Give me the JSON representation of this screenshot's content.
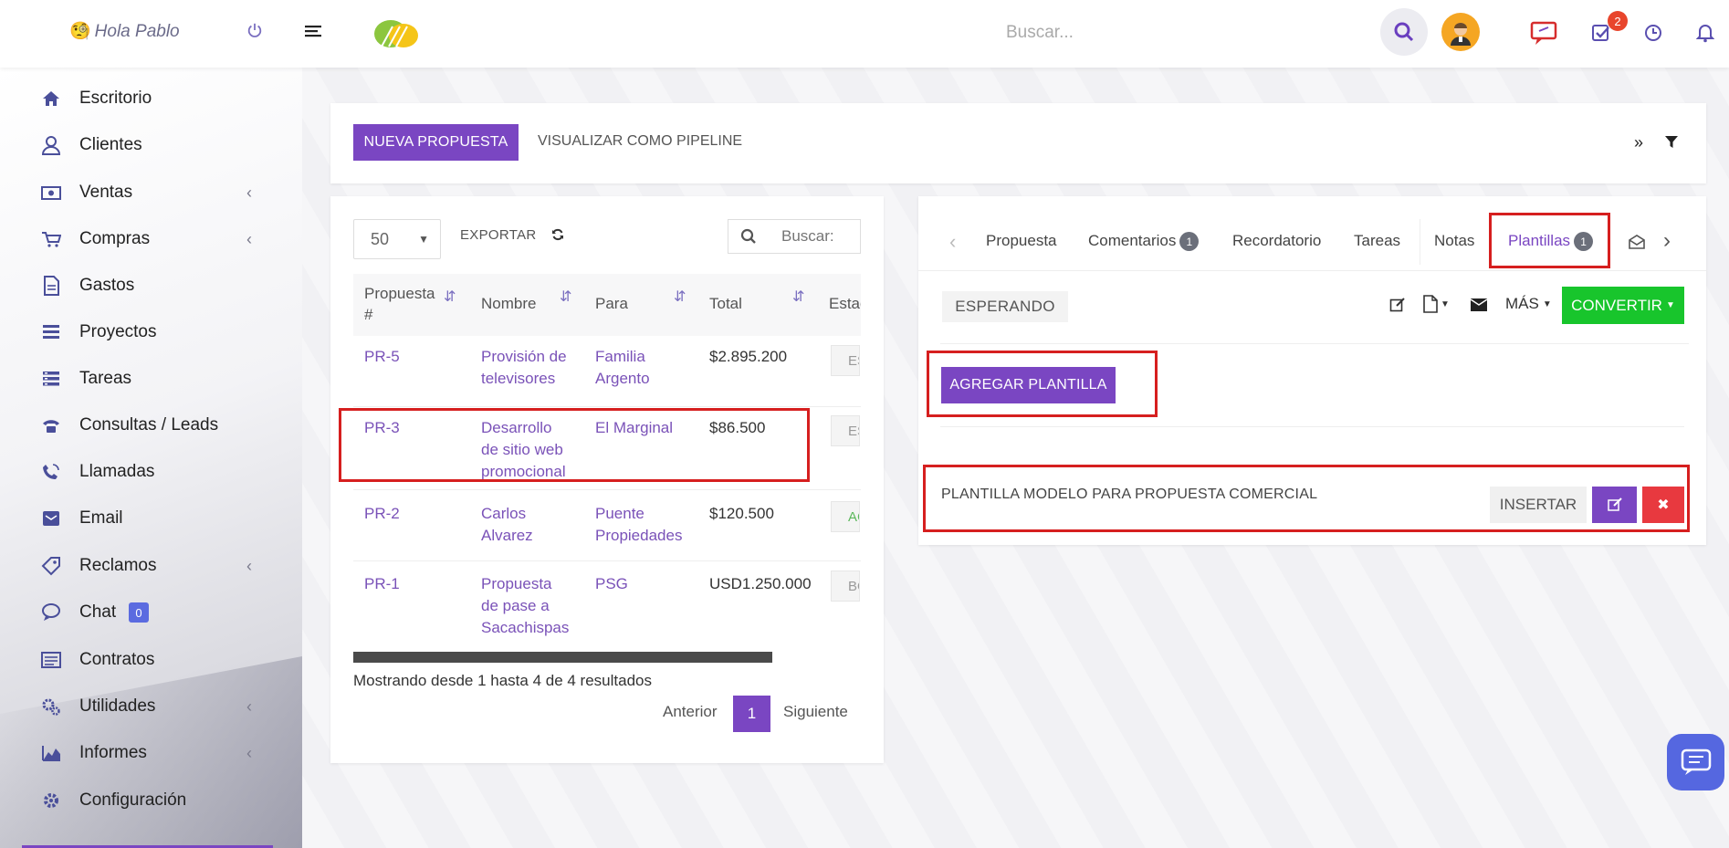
{
  "topbar": {
    "greeting": "Hola Pablo",
    "search_placeholder": "Buscar...",
    "notifications_badge": "2",
    "colors": {
      "accent": "#7a46c2",
      "badge": "#e8452c"
    }
  },
  "sidebar": {
    "items": [
      {
        "label": "Escritorio",
        "icon": "home-icon"
      },
      {
        "label": "Clientes",
        "icon": "user-icon"
      },
      {
        "label": "Ventas",
        "icon": "money-icon",
        "chevron": true
      },
      {
        "label": "Compras",
        "icon": "cart-icon",
        "chevron": true
      },
      {
        "label": "Gastos",
        "icon": "document-icon"
      },
      {
        "label": "Proyectos",
        "icon": "list-icon"
      },
      {
        "label": "Tareas",
        "icon": "tasks-icon"
      },
      {
        "label": "Consultas / Leads",
        "icon": "phone-icon"
      },
      {
        "label": "Llamadas",
        "icon": "call-icon"
      },
      {
        "label": "Email",
        "icon": "email-icon"
      },
      {
        "label": "Reclamos",
        "icon": "tag-icon",
        "chevron": true
      },
      {
        "label": "Chat",
        "icon": "chat-icon",
        "badge": "0"
      },
      {
        "label": "Contratos",
        "icon": "contract-icon"
      },
      {
        "label": "Utilidades",
        "icon": "cogs-icon",
        "chevron": true
      },
      {
        "label": "Informes",
        "icon": "area-chart-icon",
        "chevron": true
      },
      {
        "label": "Configuración",
        "icon": "gear-icon"
      }
    ]
  },
  "toolbar": {
    "new_label": "NUEVA PROPUESTA",
    "pipeline_label": "VISUALIZAR COMO PIPELINE"
  },
  "table": {
    "page_size": "50",
    "export_label": "EXPORTAR",
    "search_placeholder": "Buscar:",
    "headers": [
      "Propuesta #",
      "Nombre",
      "Para",
      "Total",
      "Estado"
    ],
    "rows": [
      {
        "id": "PR-5",
        "nombre": [
          "Provisión de",
          "televisores"
        ],
        "para": [
          "Familia",
          "Argento"
        ],
        "total": "$2.895.200",
        "estado": "ESPERANDO"
      },
      {
        "id": "PR-3",
        "nombre": [
          "Desarrollo",
          "de sitio web",
          "promocional"
        ],
        "para": [
          "El Marginal"
        ],
        "total": "$86.500",
        "estado": "ESPERANDO"
      },
      {
        "id": "PR-2",
        "nombre": [
          "Carlos",
          "Alvarez"
        ],
        "para": [
          "Puente",
          "Propiedades"
        ],
        "total": "$120.500",
        "estado": "ACEPTADO"
      },
      {
        "id": "PR-1",
        "nombre": [
          "Propuesta",
          "de pase a",
          "Sacachispas"
        ],
        "para": [
          "PSG"
        ],
        "total": "USD1.250.000",
        "estado": "BORRADOR"
      }
    ],
    "info": "Mostrando desde 1 hasta 4 de 4 resultados",
    "pagination": {
      "prev": "Anterior",
      "current": "1",
      "next": "Siguiente"
    }
  },
  "detail": {
    "tabs": [
      {
        "label": "Propuesta"
      },
      {
        "label": "Comentarios",
        "badge": "1"
      },
      {
        "label": "Recordatorio"
      },
      {
        "label": "Tareas"
      },
      {
        "label": "Notas"
      },
      {
        "label": "Plantillas",
        "badge": "1"
      }
    ],
    "status": "ESPERANDO",
    "more_label": "MÁS",
    "convert_label": "CONVERTIR",
    "add_template_label": "AGREGAR PLANTILLA",
    "template_name": "PLANTILLA MODELO PARA PROPUESTA COMERCIAL",
    "insert_label": "INSERTAR"
  }
}
